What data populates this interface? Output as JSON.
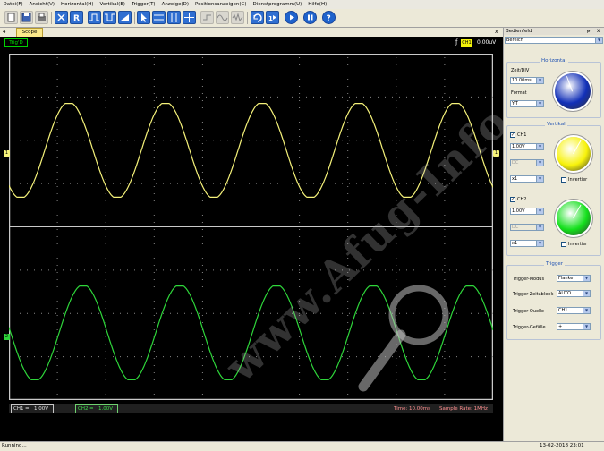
{
  "menu": [
    "Datei(F)",
    "Ansicht(V)",
    "Horizontal(H)",
    "Vertikal(E)",
    "Trigger(T)",
    "Anzeige(D)",
    "Positionsanzeigen(C)",
    "Dienstprogramm(U)",
    "Hilfe(H)"
  ],
  "tab": {
    "label": "Scope",
    "left_arrow": "4",
    "close": "x"
  },
  "scope": {
    "trig_state": "Trig'D",
    "trigger_channel": "CH1",
    "trigger_level": "0.00uV",
    "ch1_marker": "1",
    "ch2_marker": "2",
    "ch1_scale": "1.00V",
    "ch2_scale": "1.00V",
    "ch1_name": "CH1",
    "ch2_name": "CH2",
    "coupling_symbol": "=",
    "time_text": "Time: 10.00ms",
    "sample_rate_text": "Sample Rate: 1MHz",
    "ch1_color": "#f5f27a",
    "ch2_color": "#2ed63a"
  },
  "panel": {
    "title": "Bedienfeld",
    "pin": "ᵽ",
    "close": "x",
    "mode_select": "Bereich",
    "horizontal": {
      "title": "Horizontal",
      "zeitdiv_label": "Zeit/DIV",
      "zeitdiv_value": "10.00ms",
      "format_label": "Format",
      "format_value": "Y-T",
      "knob_color": "#1230b8"
    },
    "vertikal": {
      "title": "Vertikal",
      "ch1": {
        "label": "CH1",
        "checked": "✓",
        "volts": "1.00V",
        "coupling": "DC",
        "probe": "x1",
        "invert_label": "Invertier",
        "knob_color": "#f7f20a"
      },
      "ch2": {
        "label": "CH2",
        "checked": "✓",
        "volts": "1.00V",
        "coupling": "DC",
        "probe": "x1",
        "invert_label": "Invertier",
        "knob_color": "#14e01c"
      }
    },
    "trigger": {
      "title": "Trigger",
      "modus_label": "Trigger-Modus",
      "modus_value": "Flanke",
      "zeitablenk_label": "Trigger-Zeitablenk",
      "zeitablenk_value": "AUTO",
      "quelle_label": "Trigger-Quelle",
      "quelle_value": "CH1",
      "gefaelle_label": "Trigger-Gefälle",
      "gefaelle_value": "+"
    }
  },
  "statusbar": {
    "left": "Running...",
    "right": "13-02-2018  23:01"
  },
  "watermark": "www.Afug-Info.de",
  "dropdown_arrow": "▼"
}
